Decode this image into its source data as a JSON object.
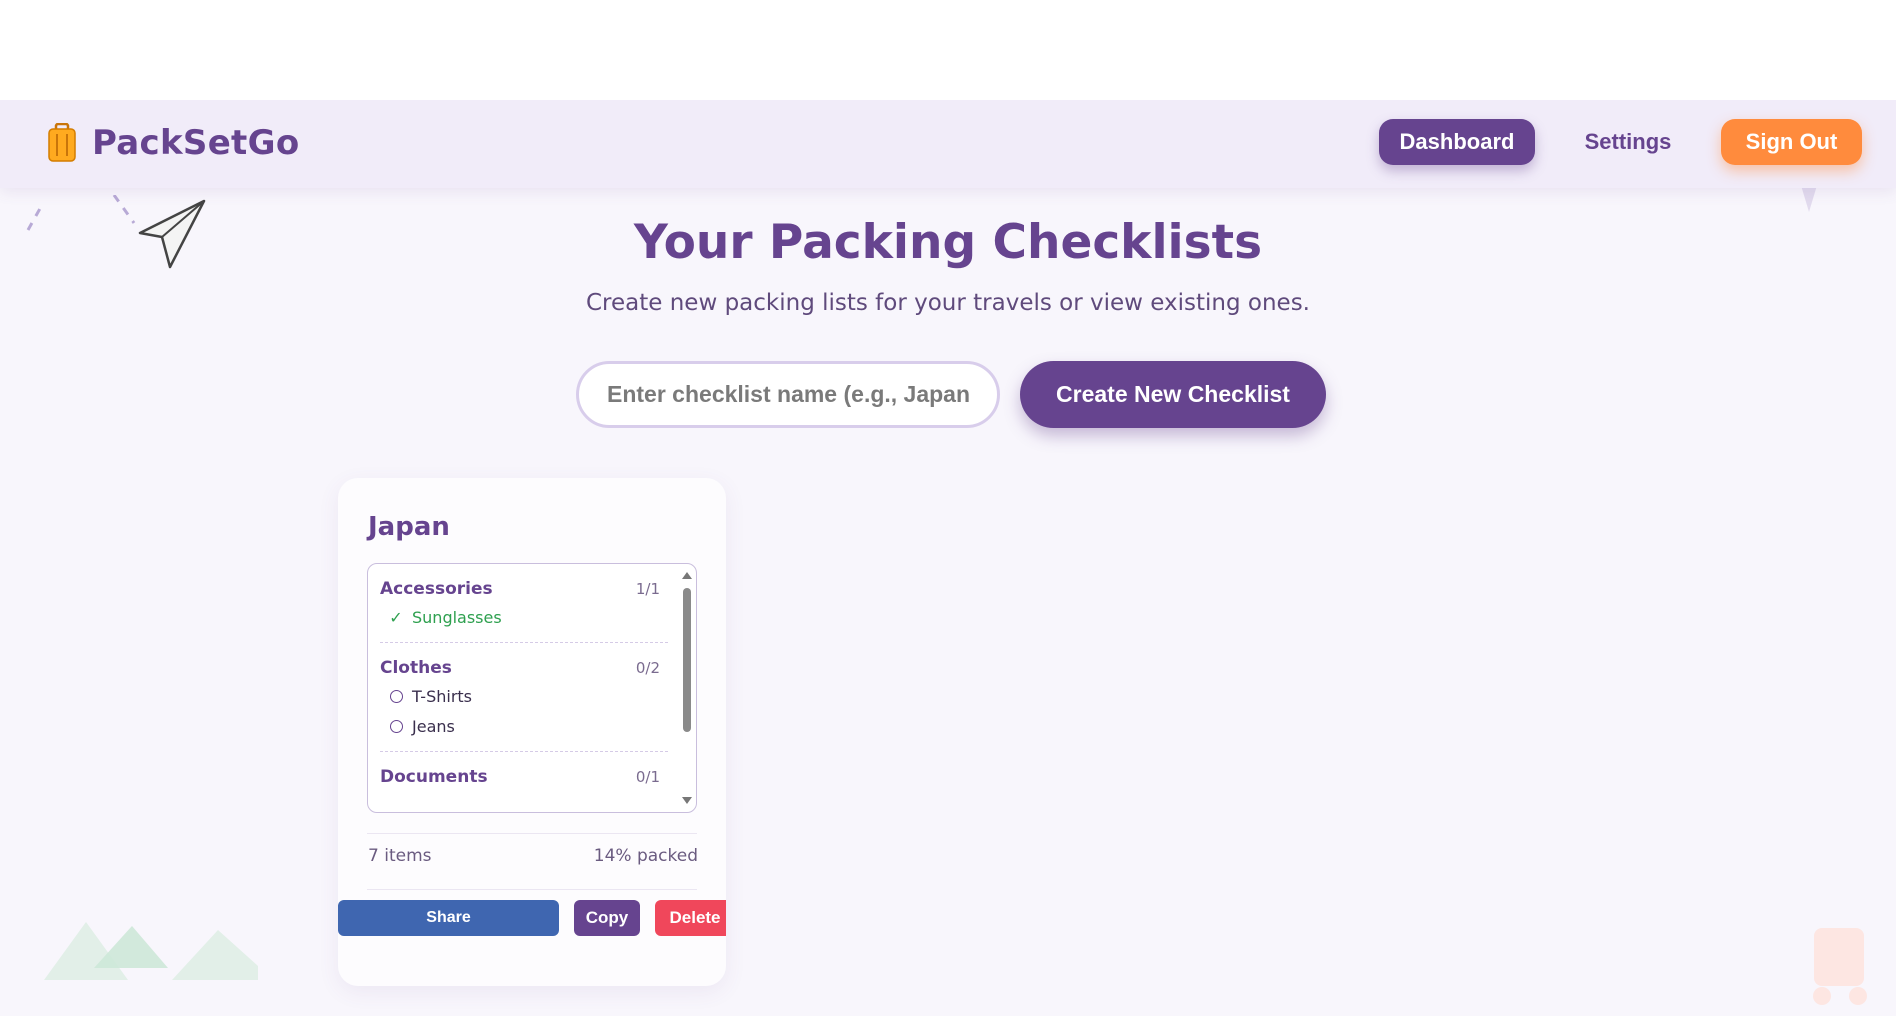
{
  "app": {
    "name": "PackSetGo"
  },
  "nav": {
    "dashboard": "Dashboard",
    "settings": "Settings",
    "sign_out": "Sign Out"
  },
  "hero": {
    "title": "Your Packing Checklists",
    "subtitle": "Create new packing lists for your travels or view existing ones."
  },
  "create": {
    "placeholder": "Enter checklist name (e.g., Japan",
    "button": "Create New Checklist"
  },
  "checklists": [
    {
      "name": "Japan",
      "categories": [
        {
          "name": "Accessories",
          "count": "1/1",
          "items": [
            {
              "label": "Sunglasses",
              "packed": true
            }
          ]
        },
        {
          "name": "Clothes",
          "count": "0/2",
          "items": [
            {
              "label": "T-Shirts",
              "packed": false
            },
            {
              "label": "Jeans",
              "packed": false
            }
          ]
        },
        {
          "name": "Documents",
          "count": "0/1",
          "items": []
        }
      ],
      "items_text": "7 items",
      "packed_text": "14% packed",
      "actions": {
        "share": "Share",
        "copy": "Copy",
        "delete": "Delete"
      }
    }
  ],
  "icons": {
    "logo": "suitcase-icon",
    "packed": "checkmark-icon",
    "unpacked": "circle-icon"
  },
  "colors": {
    "brand": "#66448f",
    "accent": "#ff8b3d",
    "share": "#3f66b0",
    "delete": "#f0475b",
    "packed": "#2ea04f"
  }
}
